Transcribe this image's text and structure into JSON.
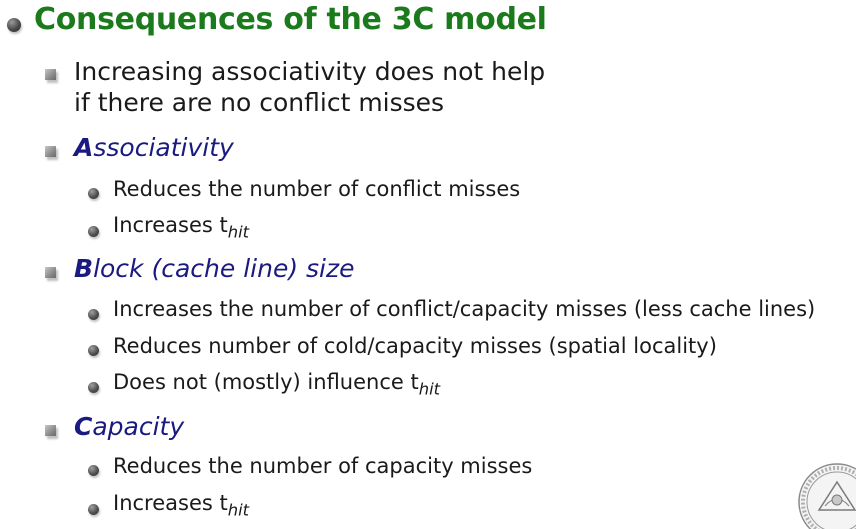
{
  "title": "Consequences of the 3C model",
  "items": [
    {
      "line1": "Increasing associativity does not help",
      "line2": "if there are no conflict misses"
    },
    {
      "initial": "A",
      "rest": "ssociativity",
      "subitems": [
        {
          "text": "Reduces the number of conflict misses"
        },
        {
          "text": "Increases t",
          "sub": "hit"
        }
      ]
    },
    {
      "initial": "B",
      "rest": "lock (cache line) size",
      "subitems": [
        {
          "text": "Increases the number of conflict/capacity misses (less cache lines)"
        },
        {
          "text": "Reduces number of cold/capacity misses (spatial locality)"
        },
        {
          "text": "Does not (mostly) influence t",
          "sub": "hit"
        }
      ]
    },
    {
      "initial": "C",
      "rest": "apacity",
      "subitems": [
        {
          "text": "Reduces the number of capacity misses"
        },
        {
          "text": "Increases t",
          "sub": "hit"
        }
      ]
    }
  ],
  "colors": {
    "title": "#1b7a1b",
    "heading": "#1a1a80",
    "text": "#1a1a1a"
  },
  "icons": {
    "title_bullet": "round-bullet-icon",
    "level1_bullet": "square-bullet-icon",
    "level2_bullet": "round-bullet-icon",
    "corner": "university-seal-icon"
  }
}
